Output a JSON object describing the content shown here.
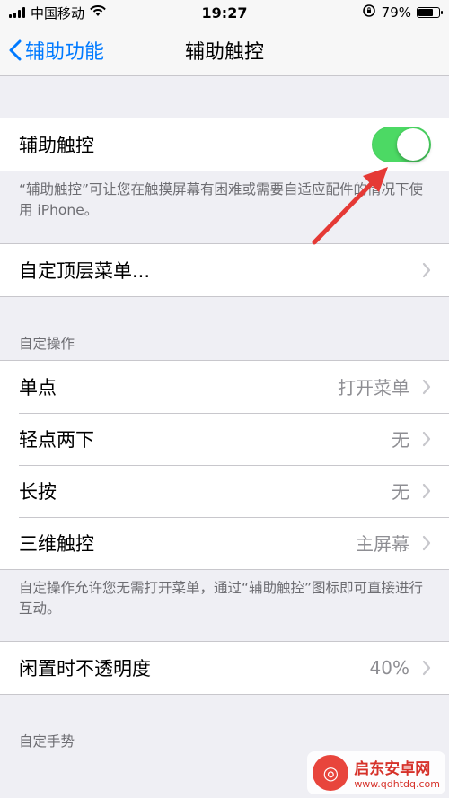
{
  "status_bar": {
    "carrier": "中国移动",
    "time": "19:27",
    "battery": "79%",
    "battery_level": 0.79
  },
  "nav": {
    "back_label": "辅助功能",
    "title": "辅助触控"
  },
  "toggle_row": {
    "label": "辅助触控",
    "state": "on",
    "note": "“辅助触控”可让您在触摸屏幕有困难或需要自适应配件的情况下使用 iPhone。"
  },
  "top_menu": {
    "label": "自定顶层菜单..."
  },
  "custom_actions": {
    "header": "自定操作",
    "rows": [
      {
        "label": "单点",
        "value": "打开菜单"
      },
      {
        "label": "轻点两下",
        "value": "无"
      },
      {
        "label": "长按",
        "value": "无"
      },
      {
        "label": "三维触控",
        "value": "主屏幕"
      }
    ],
    "note": "自定操作允许您无需打开菜单，通过“辅助触控”图标即可直接进行互动。"
  },
  "idle_opacity": {
    "label": "闲置时不透明度",
    "value": "40%"
  },
  "custom_gestures": {
    "header": "自定手势"
  },
  "watermark": {
    "title": "启东安卓网",
    "url": "www.qdhtdq.com"
  },
  "colors": {
    "accent": "#007aff",
    "toggle_on": "#4cd964",
    "annotation_arrow": "#e53935"
  }
}
